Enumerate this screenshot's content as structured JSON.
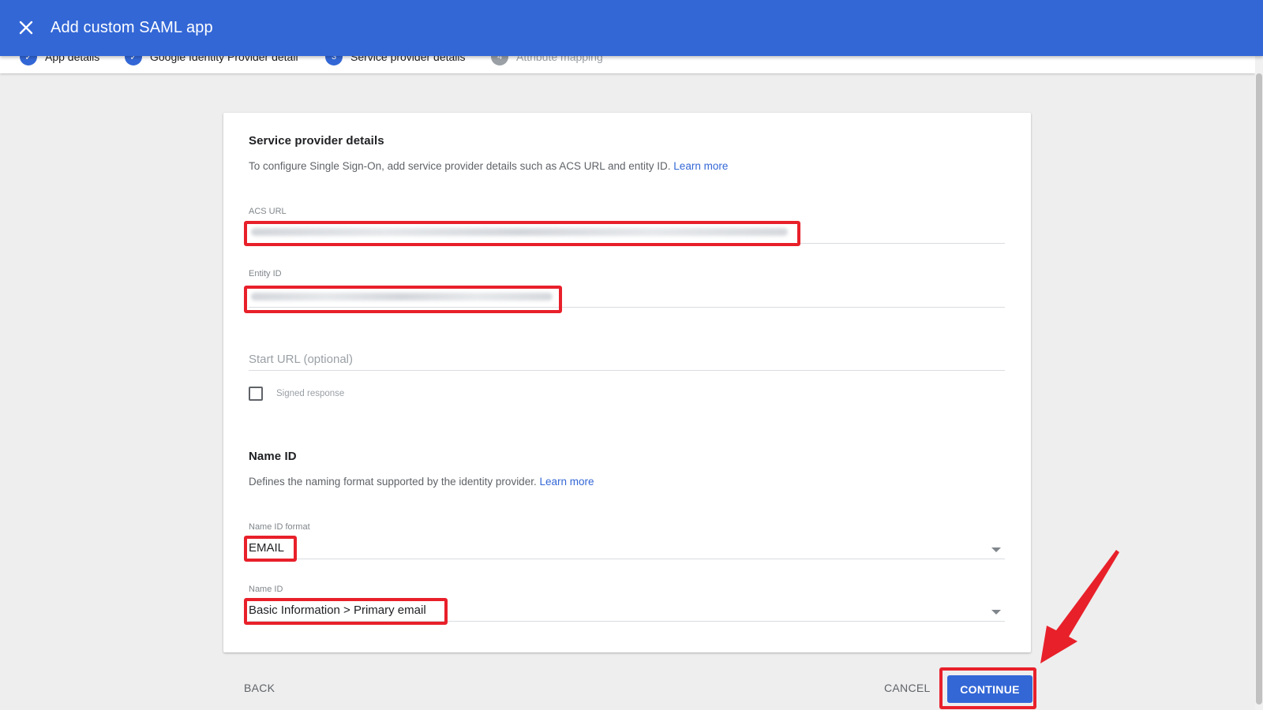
{
  "header": {
    "title": "Add custom SAML app",
    "close_icon": "close-icon",
    "background": "#3367d6"
  },
  "stepper": {
    "steps": [
      {
        "number": "✓",
        "label": "App details",
        "state": "done"
      },
      {
        "number": "✓",
        "label": "Google Identity Provider detail",
        "state": "done"
      },
      {
        "number": "3",
        "label": "Service provider details",
        "state": "current"
      },
      {
        "number": "4",
        "label": "Attribute mapping",
        "state": "inactive"
      }
    ]
  },
  "service_provider": {
    "title": "Service provider details",
    "description": "To configure Single Sign-On, add service provider details such as ACS URL and entity ID.",
    "learn_more": "Learn more",
    "acs_url_label": "ACS URL",
    "entity_id_label": "Entity ID",
    "start_url_placeholder": "Start URL (optional)",
    "signed_response_label": "Signed response",
    "signed_response_checked": false
  },
  "name_id": {
    "title": "Name ID",
    "description": "Defines the naming format supported by the identity provider.",
    "learn_more": "Learn more",
    "format_label": "Name ID format",
    "format_value": "EMAIL",
    "name_id_label": "Name ID",
    "name_id_value": "Basic Information > Primary email"
  },
  "footer": {
    "back": "BACK",
    "cancel": "CANCEL",
    "continue": "CONTINUE"
  },
  "colors": {
    "accent": "#3367d6",
    "highlight": "#e8202a"
  }
}
